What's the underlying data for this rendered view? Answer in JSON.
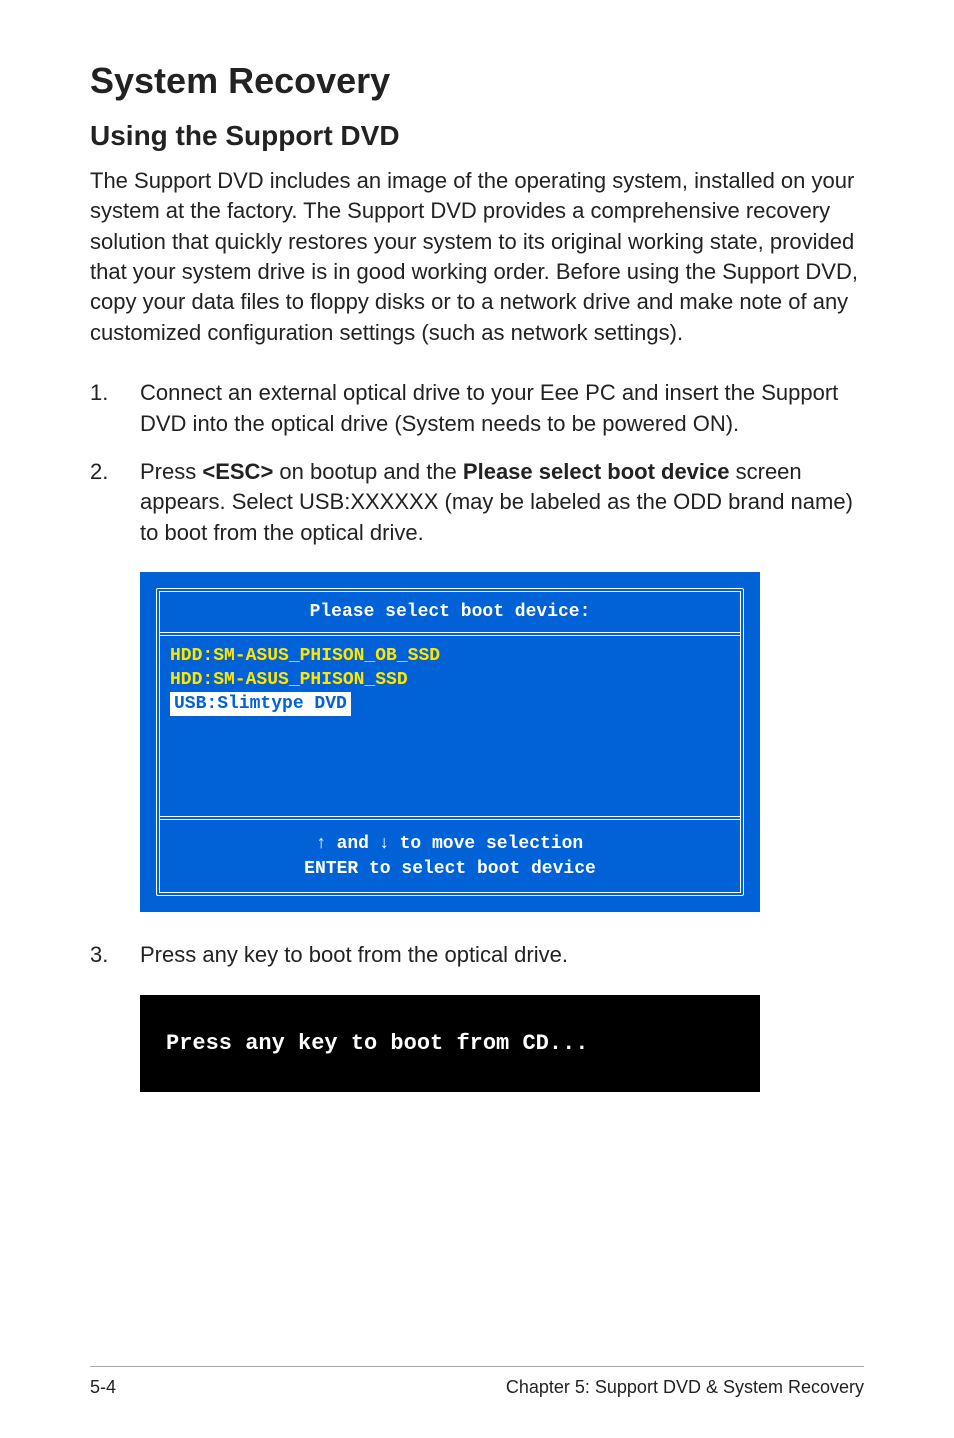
{
  "title": "System Recovery",
  "subtitle": "Using the Support DVD",
  "intro": "The Support DVD includes an image of the operating system, installed on your system at the factory. The Support DVD provides a comprehensive recovery solution that quickly restores your system to its original working state, provided that your system drive is in good working order. Before using the Support DVD, copy your data files to floppy disks or to a network drive and make note of any customized configuration settings (such as network settings).",
  "steps": {
    "s1_num": "1.",
    "s1_text": "Connect an external optical drive to your Eee PC and insert the Support DVD into the optical drive (System needs to be powered ON).",
    "s2_num": "2.",
    "s2_pre": "Press ",
    "s2_esc": "<ESC>",
    "s2_mid": " on bootup and the ",
    "s2_bold": "Please select boot device",
    "s2_post": " screen appears. Select USB:XXXXXX (may be labeled as the ODD brand name) to boot from the optical drive.",
    "s3_num": "3.",
    "s3_text": "Press any key to boot from the optical drive."
  },
  "boot": {
    "header": "Please select boot device:",
    "lines": [
      "HDD:SM-ASUS_PHISON_OB_SSD",
      "HDD:SM-ASUS_PHISON_SSD",
      "USB:Slimtype DVD"
    ],
    "footer1_pre": " and ",
    "footer1_post": " to move selection",
    "footer2": "ENTER to select boot device"
  },
  "black": {
    "text": "Press any key to boot from CD..."
  },
  "footer": {
    "page": "5-4",
    "chapter": "Chapter 5: Support DVD & System Recovery"
  }
}
